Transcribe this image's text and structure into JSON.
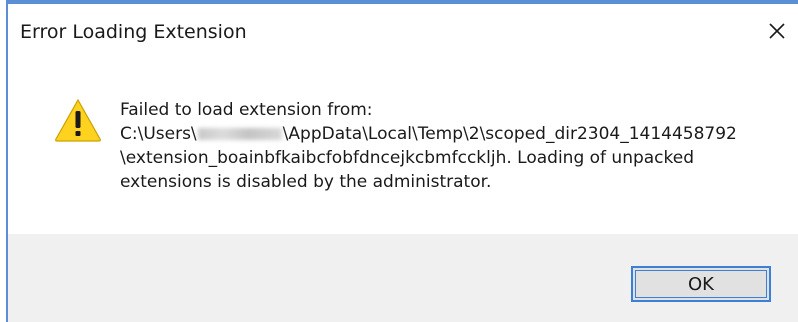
{
  "dialog": {
    "title": "Error Loading Extension",
    "close_icon": "close-icon",
    "warning_icon": "warning-icon",
    "message": {
      "line1": "Failed to load extension from:",
      "line2_prefix": "C:\\Users\\",
      "line2_suffix": "\\AppData\\Local\\Temp\\2\\scoped_dir2304_1414458792",
      "line3": "\\extension_boainbfkaibcfobfdncejkcbmfcckljh. Loading of unpacked",
      "line4": "extensions is disabled by the administrator."
    },
    "ok_label": "OK"
  },
  "colors": {
    "accent": "#3c7fd6",
    "window_border": "#5a8fd6",
    "footer_bg": "#f0f0f0",
    "warning_yellow": "#ffd21f"
  }
}
